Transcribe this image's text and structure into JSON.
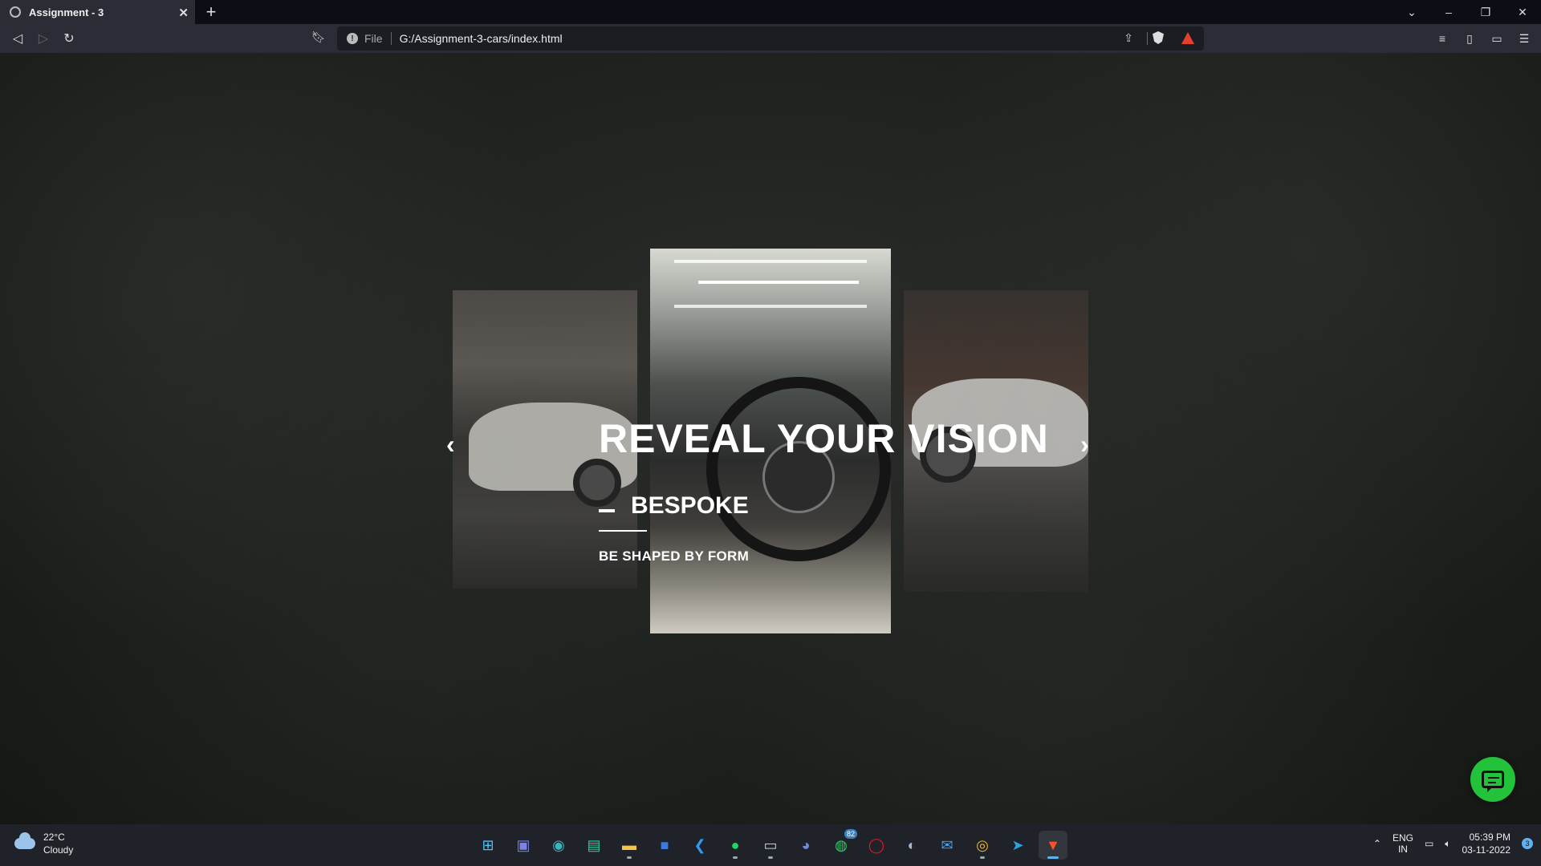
{
  "browser": {
    "tab_title": "Assignment - 3",
    "new_tab_symbol": "+",
    "url_scheme": "File",
    "url": "G:/Assignment-3-cars/index.html"
  },
  "hero": {
    "headline": "REVEAL YOUR VISION",
    "subheading": "BESPOKE",
    "tagline": "BE SHAPED BY FORM"
  },
  "carousel": {
    "prev_symbol": "‹",
    "next_symbol": "›"
  },
  "taskbar": {
    "weather_temp": "22°C",
    "weather_desc": "Cloudy",
    "whatsapp_badge": "82",
    "lang_line1": "ENG",
    "lang_line2": "IN",
    "time": "05:39 PM",
    "date": "03-11-2022",
    "notification_count": "3"
  }
}
